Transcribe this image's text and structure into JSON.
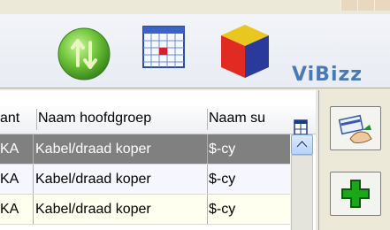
{
  "toolbar": {
    "icons": [
      "sync-icon",
      "calendar-icon",
      "cube-logo-icon"
    ],
    "brand": "ViBizz"
  },
  "grid": {
    "headers": [
      "ant",
      "Naam hoofdgroep",
      "Naam su"
    ],
    "rows": [
      {
        "c1": "KA",
        "c2": "Kabel/draad koper",
        "c3": "$-cy",
        "selected": true
      },
      {
        "c1": "KA",
        "c2": "Kabel/draad koper",
        "c3": "$-cy",
        "selected": false
      },
      {
        "c1": "KA",
        "c2": "Kabel/draad koper",
        "c3": "$-cy",
        "selected": false
      }
    ]
  },
  "side_buttons": [
    "payment-card-icon",
    "add-icon"
  ],
  "colors": {
    "selected_row": "#808080",
    "brand": "#4a79b8",
    "add_green": "#18a818"
  }
}
